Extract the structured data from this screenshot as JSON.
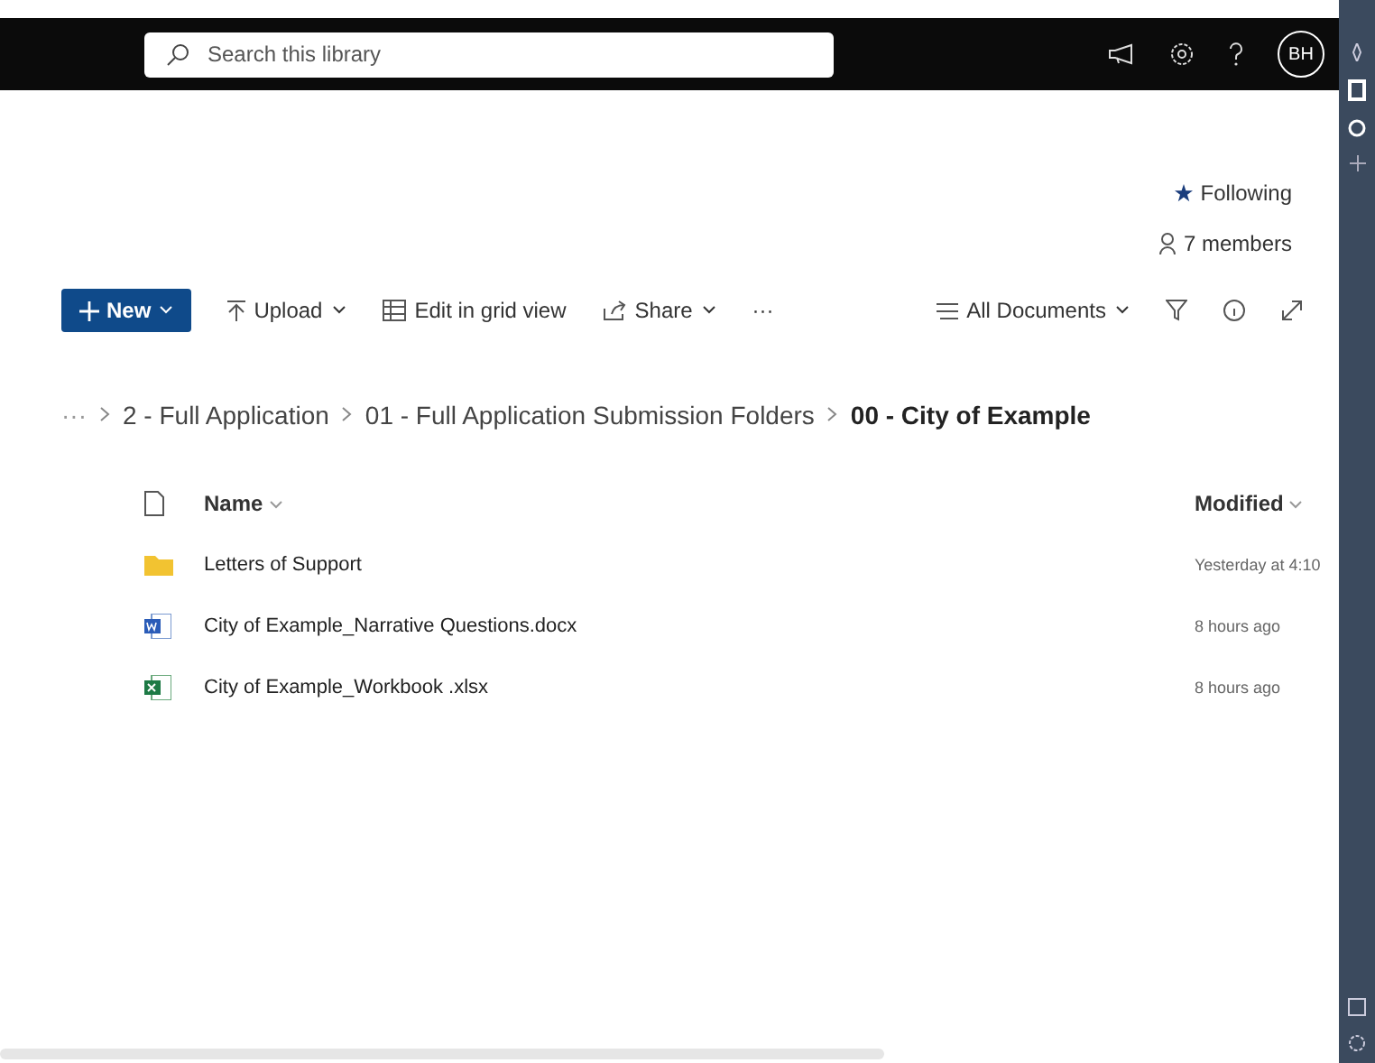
{
  "header": {
    "search": {
      "placeholder": "Search this library"
    },
    "avatar": "BH"
  },
  "site": {
    "following": "Following",
    "members": "7 members"
  },
  "commands": {
    "new": "New",
    "upload": "Upload",
    "grid": "Edit in grid view",
    "share": "Share",
    "more": "···",
    "view": "All Documents"
  },
  "breadcrumb": {
    "overflow": "···",
    "items": [
      "2 - Full Application",
      "01 - Full Application Submission Folders",
      "00 - City of Example"
    ]
  },
  "table": {
    "columns": [
      "Name",
      "Modified"
    ],
    "rows": [
      {
        "kind": "folder",
        "name": "Letters of Support",
        "modified": "Yesterday at 4:10"
      },
      {
        "kind": "word",
        "name": "City of Example_Narrative Questions.docx",
        "modified": "8 hours ago"
      },
      {
        "kind": "excel",
        "name": "City of Example_Workbook .xlsx",
        "modified": "8 hours ago"
      }
    ]
  }
}
